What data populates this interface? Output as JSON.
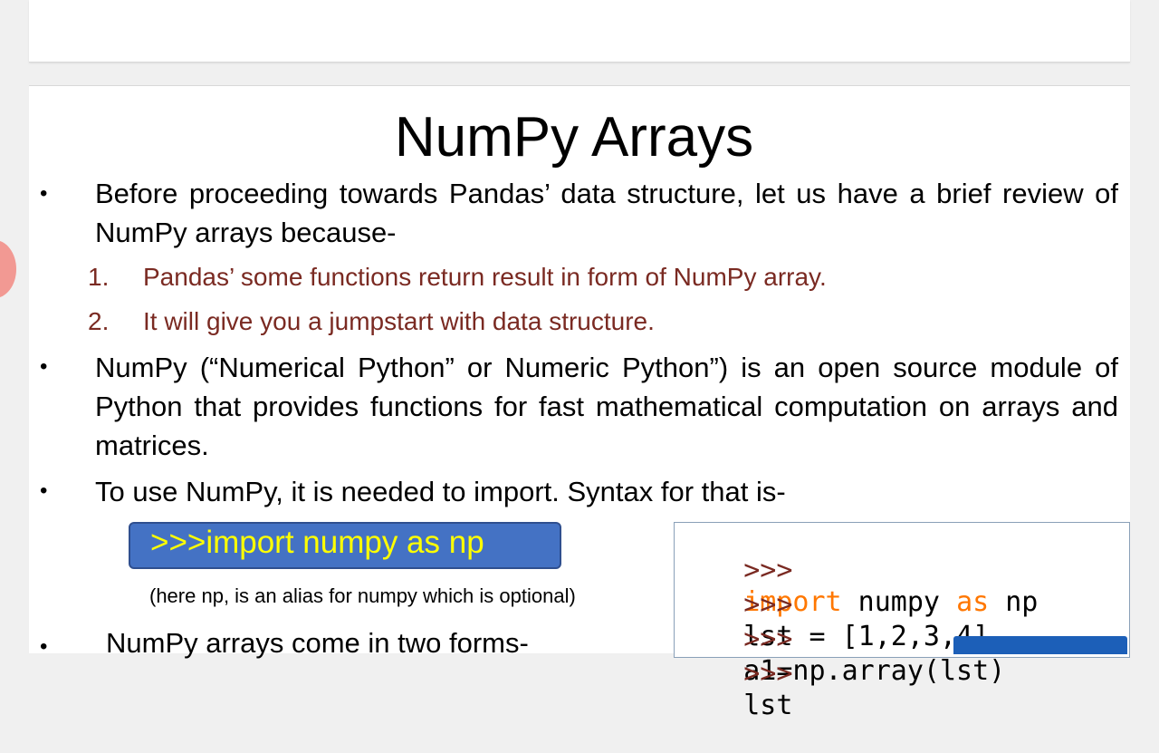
{
  "slide": {
    "title": "NumPy Arrays",
    "bullet_symbol": "•",
    "bullets": [
      "Before proceeding towards Pandas’ data structure, let us have a brief review of NumPy arrays because-",
      "NumPy (“Numerical Python” or Numeric Python”) is an open source module of Python that provides functions for fast mathematical computation on arrays and matrices.",
      "To use NumPy, it is needed to import. Syntax for that is-",
      "NumPy arrays come in two forms-"
    ],
    "reasons": [
      {
        "num": "1.",
        "text": "Pandas’ some functions return result in form of NumPy array."
      },
      {
        "num": "2.",
        "text": "It will give you a jumpstart with data structure."
      }
    ],
    "syntax_box": ">>>import numpy as np",
    "syntax_note": "(here np, is an alias for numpy which is optional)"
  },
  "shell": {
    "lines": [
      {
        "prompt": ">>>",
        "parts": [
          {
            "t": "import",
            "kw": true
          },
          {
            "t": " numpy ",
            "kw": false
          },
          {
            "t": "as",
            "kw": true
          },
          {
            "t": " np",
            "kw": false
          }
        ]
      },
      {
        "prompt": ">>>",
        "parts": [
          {
            "t": "lst = [1,2,3,4]",
            "kw": false
          }
        ]
      },
      {
        "prompt": ">>>",
        "parts": [
          {
            "t": "a1=np.array(lst)",
            "kw": false
          }
        ]
      },
      {
        "prompt": ">>>",
        "parts": [
          {
            "t": "lst",
            "kw": false
          }
        ]
      }
    ]
  },
  "colors": {
    "reason_text": "#7a2a22",
    "syntax_box_bg": "#4472c4",
    "syntax_box_text": "#ffff00",
    "shell_keyword": "#ff7700",
    "shell_prompt": "#7a2a22"
  }
}
